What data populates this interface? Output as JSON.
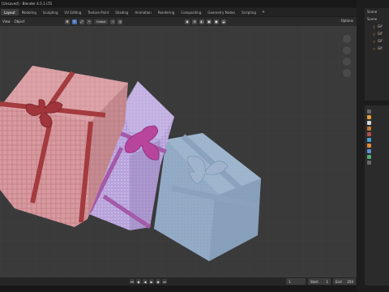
{
  "window": {
    "title": "[Unsaved] - Blender 4.5.1 LTS",
    "controls": [
      "–",
      "□",
      "×"
    ]
  },
  "workspaces": {
    "tabs": [
      "Layout",
      "Modeling",
      "Sculpting",
      "UV Editing",
      "Texture Paint",
      "Shading",
      "Animation",
      "Rendering",
      "Compositing",
      "Geometry Nodes",
      "Scripting"
    ],
    "active": "Layout",
    "add_label": "+"
  },
  "viewport_header": {
    "menus": [
      "View",
      "Object"
    ],
    "orientation_value": "Global",
    "options_label": "Options"
  },
  "timeline": {
    "start_label": "Start",
    "start_value": "1",
    "end_label": "End",
    "end_value": "250",
    "current_frame": "1"
  },
  "outliner": {
    "header_label": "Scene",
    "scene_collection": "Scene",
    "rows": [
      "Gif",
      "Gif",
      "Gif",
      "Gif"
    ]
  },
  "colors": {
    "viewport_bg": "#3a3a3a",
    "active_tab": "#3b3b3b",
    "accent": "#4772b3",
    "gift_pink": "#d89a9e",
    "gift_purple": "#b9a3d8",
    "gift_blue": "#8fa7c2",
    "object_icon": "#e08a3a"
  }
}
